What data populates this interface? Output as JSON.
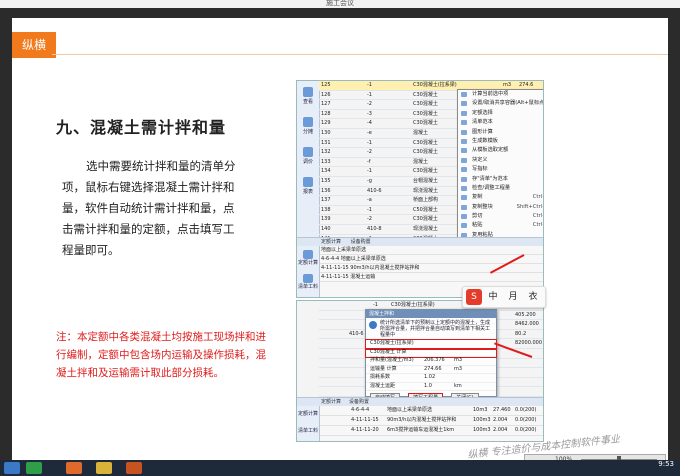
{
  "window": {
    "title": "施工会议"
  },
  "slide": {
    "logo_text": "纵横",
    "heading": "九、混凝土需计拌和量",
    "body": "选中需要统计拌和量的清单分项，鼠标右键选择混凝土需计拌和量，软件自动统计需计拌和量，点击需计拌和量的定额，点击填写工程量即可。",
    "note": "注：本定额中各类混凝土均按施工现场拌和进行编制，定额中包含场内运输及操作损耗，混凝土拌和及运输需计取此部分损耗。",
    "watermark": "纵横 专注造价与成本控制软件事业"
  },
  "shot1": {
    "sidebar": [
      "查看",
      "分摊",
      "调价",
      "报表"
    ],
    "rows": [
      {
        "no": "125",
        "code": "-1",
        "name": "C30混凝土(拉系梁)",
        "unit": "m3",
        "val": "274.6"
      },
      {
        "no": "126",
        "code": "-1",
        "name": "C30混凝土",
        "unit": "",
        "val": ""
      },
      {
        "no": "127",
        "code": "-2",
        "name": "C30混凝土",
        "unit": "",
        "val": ""
      },
      {
        "no": "128",
        "code": "-3",
        "name": "C30混凝土",
        "unit": "",
        "val": ""
      },
      {
        "no": "129",
        "code": "-4",
        "name": "C30混凝土",
        "unit": "",
        "val": ""
      },
      {
        "no": "130",
        "code": "-e",
        "name": "混凝土",
        "unit": "",
        "val": ""
      },
      {
        "no": "131",
        "code": "-1",
        "name": "C30混凝土",
        "unit": "",
        "val": ""
      },
      {
        "no": "132",
        "code": "-2",
        "name": "C30混凝土",
        "unit": "",
        "val": ""
      },
      {
        "no": "133",
        "code": "-f",
        "name": "混凝土",
        "unit": "",
        "val": ""
      },
      {
        "no": "134",
        "code": "-1",
        "name": "C30混凝土",
        "unit": "",
        "val": ""
      },
      {
        "no": "135",
        "code": "-g",
        "name": "台帽混凝土",
        "unit": "",
        "val": ""
      },
      {
        "no": "136",
        "code": "410-6",
        "name": "现浇混凝土",
        "unit": "",
        "val": ""
      },
      {
        "no": "137",
        "code": "-a",
        "name": "桥面上部构",
        "unit": "",
        "val": ""
      },
      {
        "no": "138",
        "code": "-1",
        "name": "C50混凝土",
        "unit": "",
        "val": ""
      },
      {
        "no": "139",
        "code": "-2",
        "name": "C30混凝土",
        "unit": "",
        "val": ""
      },
      {
        "no": "140",
        "code": "410-8",
        "name": "现浇混凝土",
        "unit": "",
        "val": ""
      },
      {
        "no": "141",
        "code": "-1",
        "name": "C30混凝土",
        "unit": "",
        "val": ""
      },
      {
        "no": "142",
        "code": "411",
        "name": "预应力混凝",
        "unit": "",
        "val": ""
      }
    ],
    "menu": [
      {
        "label": "计算当前选中项",
        "shortcut": ""
      },
      {
        "label": "设置/取消共享容器(Alt+鼠标点击)",
        "shortcut": ""
      },
      {
        "label": "定额选择",
        "shortcut": ""
      },
      {
        "label": "清单范本",
        "shortcut": ""
      },
      {
        "label": "图形计算",
        "shortcut": ""
      },
      {
        "label": "生成数模板",
        "shortcut": ""
      },
      {
        "label": "从模板选取定额",
        "shortcut": ""
      },
      {
        "label": "块定义",
        "shortcut": ""
      },
      {
        "label": "写指标",
        "shortcut": ""
      },
      {
        "label": "存\"清单\"为范本",
        "shortcut": ""
      },
      {
        "label": "检查/调整工程量",
        "shortcut": ""
      },
      {
        "label": "复制",
        "shortcut": "Ctrl+C"
      },
      {
        "label": "复制整块",
        "shortcut": "Shift+Ctrl+C"
      },
      {
        "label": "剪切",
        "shortcut": "Ctrl+X"
      },
      {
        "label": "粘贴",
        "shortcut": "Ctrl+V"
      },
      {
        "label": "复用粘贴",
        "shortcut": ""
      },
      {
        "label": "插入",
        "shortcut": "Ctrl+Ins"
      },
      {
        "label": "删除",
        "shortcut": "Ctrl+Del"
      },
      {
        "label": "节点数据设",
        "shortcut": ""
      },
      {
        "label": "混凝土需计拌和量",
        "shortcut": ""
      }
    ],
    "bottom_tabs": [
      "定额计算",
      "设备购置"
    ],
    "bottom_lines": [
      "地面以上采梁单原选",
      "4-6-4-4  地面以上采梁单原选",
      "4-11-11-15  90m3/h以内混凝土搅拌站拌和",
      "4-11-11-15  混凝土运输"
    ],
    "side2": [
      "定额计算",
      "清单工料"
    ]
  },
  "shot2": {
    "dialog_title": "混凝土拌和",
    "info": "统计所选清单下的预制以上定额中的混凝土，生成所需拌合量，并把拌合量自动填写到清单下相关工程量中",
    "rows": [
      {
        "name": "C30混凝土(拉系梁)",
        "val": "",
        "unit": ""
      },
      {
        "name": "C30混凝土 计算",
        "val": "",
        "unit": ""
      },
      {
        "name": "拌和量(混凝土/m3)",
        "val": "206.376",
        "unit": "m3"
      },
      {
        "name": "运输量 计算",
        "val": "274.66",
        "unit": "m3"
      },
      {
        "name": "损耗系数",
        "val": "1.02",
        "unit": ""
      },
      {
        "name": "混凝土运距",
        "val": "1.0",
        "unit": "km"
      }
    ],
    "buttons": [
      "自动填写",
      "填写工程量",
      "关闭(C)"
    ],
    "grid_rows": [
      {
        "code": "4-6-4-4",
        "name": "地面以上采梁单原选",
        "unit": "10m3",
        "qty": "27.460",
        "price": "0.0(200)"
      },
      {
        "code": "4-11-11-15",
        "name": "90m3/h以内混凝土搅拌站拌和",
        "unit": "100m3",
        "qty": "2.004",
        "price": "0.0(200)"
      },
      {
        "code": "4-11-11-20",
        "name": "6m3搅拌运输车运混凝土1km",
        "unit": "100m3",
        "qty": "2.004",
        "price": "0.0(200)"
      }
    ],
    "right_vals": [
      "1904.100",
      "405.200",
      "8462.000",
      "80.2",
      "82000.000"
    ]
  },
  "float_toolbar": [
    "S",
    "中",
    "月",
    "衣"
  ],
  "viewer": {
    "zoom": "100%"
  },
  "taskbar": {
    "time": "9:53"
  },
  "colors": {
    "accent": "#f07a1c",
    "note": "#e01b1b",
    "menu_sel": "#c9def7"
  }
}
